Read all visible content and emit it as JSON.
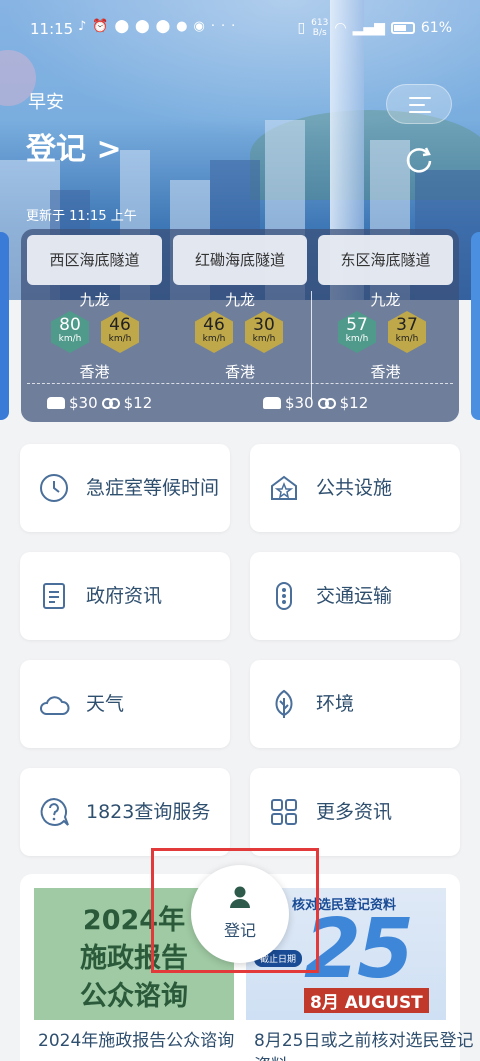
{
  "status_bar": {
    "time": "11:15",
    "net_speed_value": "613",
    "net_speed_unit": "B/s",
    "battery": "61%"
  },
  "header": {
    "greeting": "早安",
    "login_link": "登记 >",
    "updated": "更新于 11:15 上午"
  },
  "tunnels": [
    {
      "name": "西区海底隧道",
      "from": "九龙",
      "to": "香港",
      "speeds": [
        {
          "value": "80",
          "unit": "km/h",
          "color": "green"
        },
        {
          "value": "46",
          "unit": "km/h",
          "color": "yellow"
        }
      ]
    },
    {
      "name": "红磡海底隧道",
      "from": "九龙",
      "to": "香港",
      "speeds": [
        {
          "value": "46",
          "unit": "km/h",
          "color": "yellow"
        },
        {
          "value": "30",
          "unit": "km/h",
          "color": "yellow"
        }
      ]
    },
    {
      "name": "东区海底隧道",
      "from": "九龙",
      "to": "香港",
      "speeds": [
        {
          "value": "57",
          "unit": "km/h",
          "color": "green"
        },
        {
          "value": "37",
          "unit": "km/h",
          "color": "yellow"
        }
      ]
    }
  ],
  "tolls": {
    "left": {
      "car": "$30",
      "bike": "$12"
    },
    "right": {
      "car": "$30",
      "bike": "$12"
    }
  },
  "services": [
    {
      "label": "急症室等候时间",
      "icon": "clock-icon"
    },
    {
      "label": "公共设施",
      "icon": "house-star-icon"
    },
    {
      "label": "政府资讯",
      "icon": "document-icon"
    },
    {
      "label": "交通运输",
      "icon": "traffic-light-icon"
    },
    {
      "label": "天气",
      "icon": "cloud-icon"
    },
    {
      "label": "环境",
      "icon": "leaf-icon"
    },
    {
      "label": "1823查询服务",
      "icon": "question-bubble-icon"
    },
    {
      "label": "更多资讯",
      "icon": "grid-icon"
    }
  ],
  "news": [
    {
      "image_text": "2024年\n施政报告\n公众谘询",
      "caption": "2024年施政报告公众谘询"
    },
    {
      "image_head": "核对选民登记资料",
      "image_number": "25",
      "image_badge": "截止日期",
      "image_month": "8月 AUGUST",
      "caption": "8月25日或之前核对选民登记资料"
    }
  ],
  "fab": {
    "label": "登记"
  },
  "colors": {
    "accent_text": "#2f4f6f",
    "speed_green": "#4f9a8a",
    "speed_yellow": "#bfa84a",
    "highlight": "#e23a3a"
  }
}
